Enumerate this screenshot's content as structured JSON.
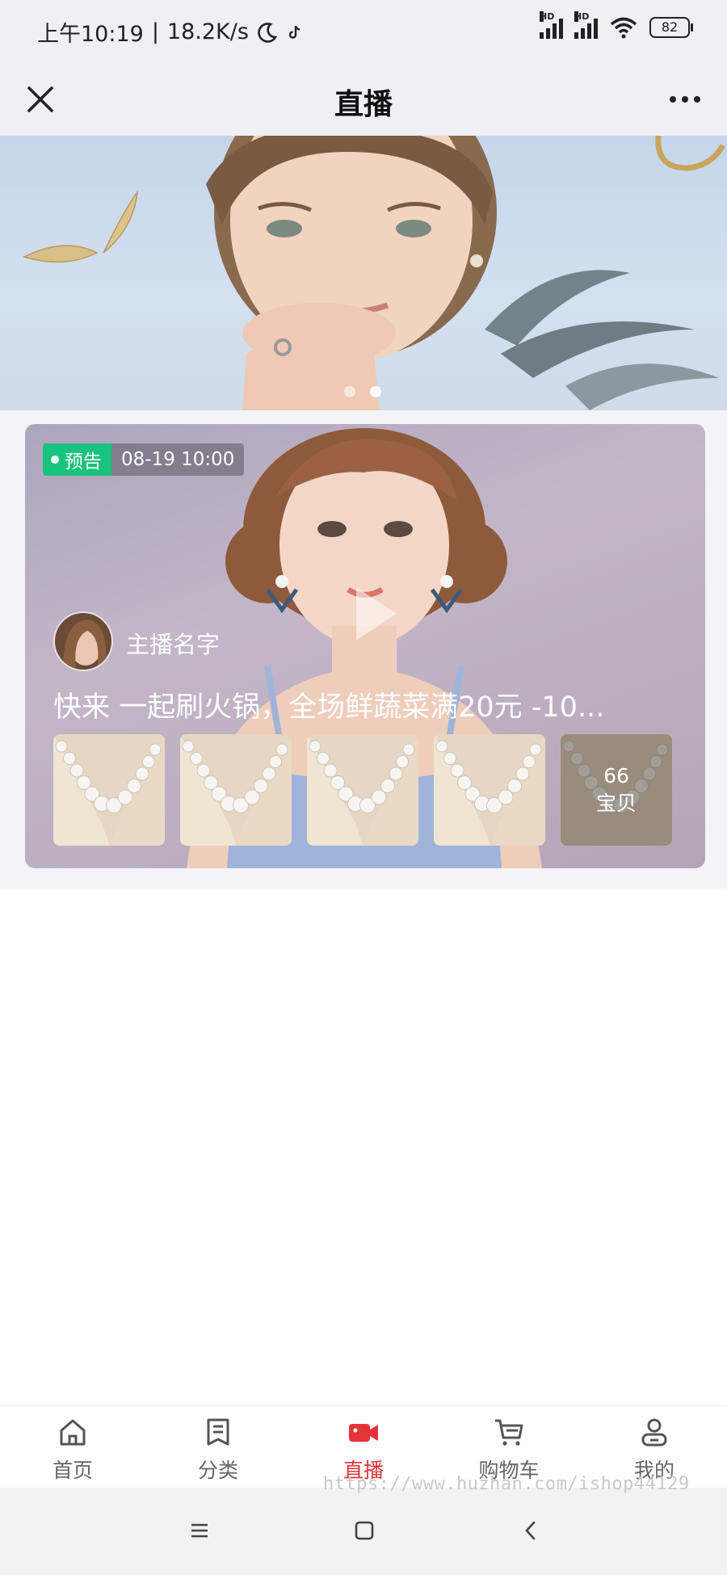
{
  "status_bar": {
    "time": "上午10:19",
    "net_speed": "18.2K/s",
    "battery": "82",
    "hd_label": "HD"
  },
  "header": {
    "title": "直播"
  },
  "banner": {
    "slide_count": 2,
    "active_slide": 2
  },
  "live": {
    "badge_label": "预告",
    "start_time": "08-19 10:00",
    "host_name": "主播名字",
    "title": "快来 一起刷火锅，全场鲜蔬菜满20元 -10...",
    "product_count": "66",
    "product_count_label": "宝贝"
  },
  "bottom_nav": {
    "items": [
      {
        "label": "首页",
        "icon": "home-icon"
      },
      {
        "label": "分类",
        "icon": "category-icon"
      },
      {
        "label": "直播",
        "icon": "live-camera-icon"
      },
      {
        "label": "购物车",
        "icon": "cart-icon"
      },
      {
        "label": "我的",
        "icon": "profile-icon"
      }
    ],
    "active_index": 2
  },
  "watermark": "https://www.huzhan.com/ishop44129",
  "colors": {
    "accent": "#e5333a",
    "badge_green": "#19c37d"
  }
}
